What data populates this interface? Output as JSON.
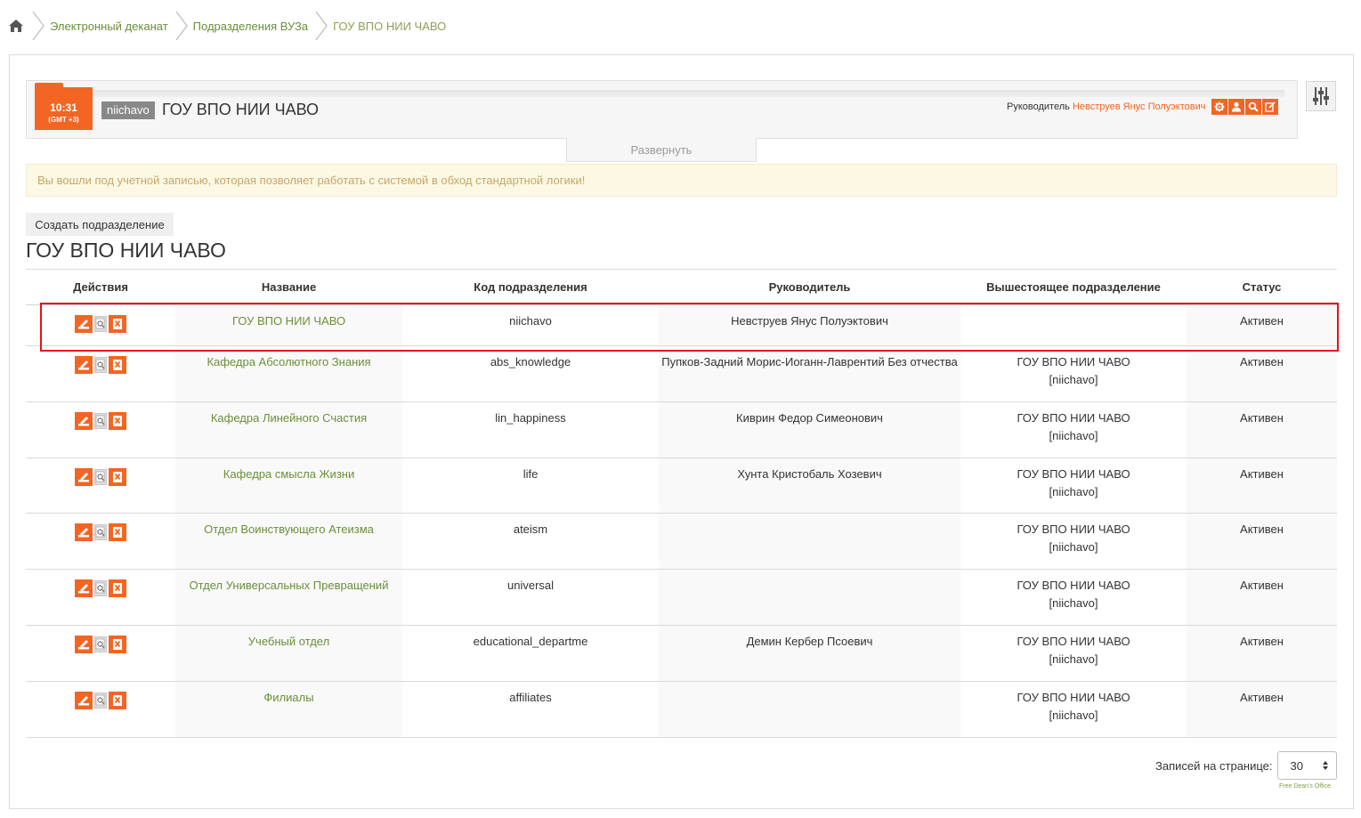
{
  "breadcrumb": {
    "home_icon": "home-icon",
    "items": [
      "Электронный деканат",
      "Подразделения ВУЗа",
      "ГОУ ВПО НИИ ЧАВО"
    ]
  },
  "header": {
    "time": "10:31",
    "timezone": "(GMT +3)",
    "code": "niichavo",
    "title": "ГОУ ВПО НИИ ЧАВО",
    "head_label": "Руководитель",
    "head_name": "Невструев Янус Полуэктович",
    "buttons": [
      "gear-icon",
      "user-icon",
      "search-icon",
      "edit-icon"
    ],
    "expand_label": "Развернуть"
  },
  "warning": "Вы вошли под учетной записью, которая позволяет работать с системой в обход стандартной логики!",
  "create_button": "Создать подразделение",
  "page_title": "ГОУ ВПО НИИ ЧАВО",
  "table": {
    "headers": [
      "Действия",
      "Название",
      "Код подразделения",
      "Руководитель",
      "Вышестоящее подразделение",
      "Статус"
    ],
    "rows": [
      {
        "name": "ГОУ ВПО НИИ ЧАВО",
        "code": "niichavo",
        "head": "Невструев Янус Полуэктович",
        "parent": "",
        "parent_code": "",
        "status": "Активен"
      },
      {
        "name": "Кафедра Абсолютного Знания",
        "code": "abs_knowledge",
        "head": "Пупков-Задний Морис-Иоганн-Лаврентий Без отчества",
        "parent": "ГОУ ВПО НИИ ЧАВО",
        "parent_code": "[niichavo]",
        "status": "Активен"
      },
      {
        "name": "Кафедра Линейного Счастия",
        "code": "lin_happiness",
        "head": "Киврин Федор Симеонович",
        "parent": "ГОУ ВПО НИИ ЧАВО",
        "parent_code": "[niichavo]",
        "status": "Активен"
      },
      {
        "name": "Кафедра смысла Жизни",
        "code": "life",
        "head": "Хунта Кристобаль Хозевич",
        "parent": "ГОУ ВПО НИИ ЧАВО",
        "parent_code": "[niichavo]",
        "status": "Активен"
      },
      {
        "name": "Отдел Воинствующего Атеизма",
        "code": "ateism",
        "head": "",
        "parent": "ГОУ ВПО НИИ ЧАВО",
        "parent_code": "[niichavo]",
        "status": "Активен"
      },
      {
        "name": "Отдел Универсальных Превращений",
        "code": "universal",
        "head": "",
        "parent": "ГОУ ВПО НИИ ЧАВО",
        "parent_code": "[niichavo]",
        "status": "Активен"
      },
      {
        "name": "Учебный отдел",
        "code": "educational_departme",
        "head": "Демин Кербер Псоевич",
        "parent": "ГОУ ВПО НИИ ЧАВО",
        "parent_code": "[niichavo]",
        "status": "Активен"
      },
      {
        "name": "Филиалы",
        "code": "affiliates",
        "head": "",
        "parent": "ГОУ ВПО НИИ ЧАВО",
        "parent_code": "[niichavo]",
        "status": "Активен"
      }
    ]
  },
  "pager": {
    "label": "Записей на странице:",
    "value": "30"
  },
  "footer_note": "Free Dean's Office",
  "colors": {
    "accent": "#f26522",
    "link": "#6b8e3a",
    "highlight": "#e3141b",
    "warning_bg": "#fcf8e3"
  }
}
